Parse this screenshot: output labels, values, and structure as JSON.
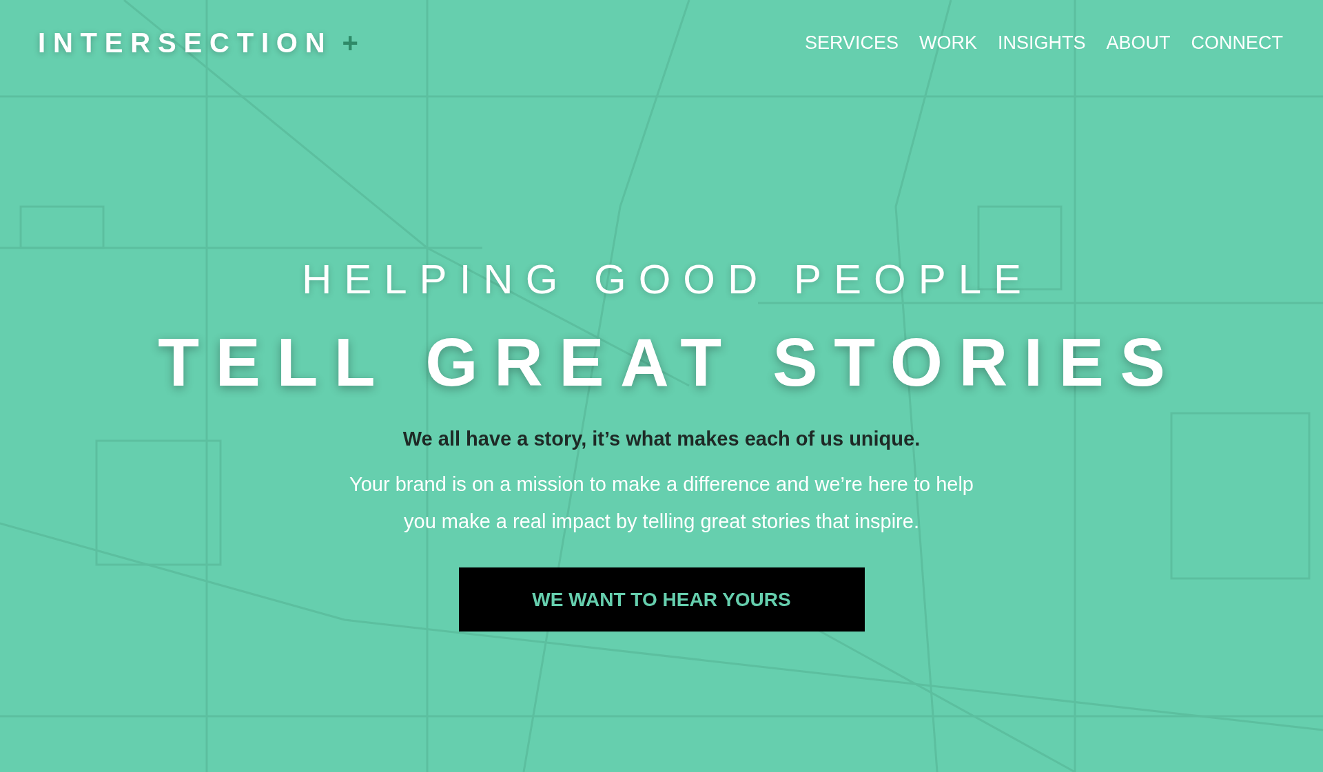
{
  "header": {
    "logo": "INTERSECTION",
    "logo_mark": "+",
    "nav": [
      {
        "label": "SERVICES"
      },
      {
        "label": "WORK"
      },
      {
        "label": "INSIGHTS"
      },
      {
        "label": "ABOUT"
      },
      {
        "label": "CONNECT"
      }
    ]
  },
  "hero": {
    "kind": "picture",
    "eyebrow": "HELPING GOOD PEOPLE",
    "title": "TELL GREAT STORIES",
    "lead": "We all have a story, it’s what makes each of us unique.",
    "body": "Your brand is on a mission to make a difference and we’re here to help you make a real impact by telling great stories that inspire.",
    "cta": "WE WANT TO HEAR YOURS"
  }
}
